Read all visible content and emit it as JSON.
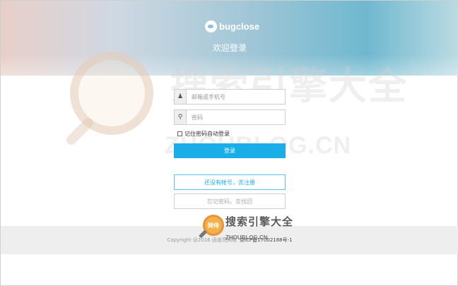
{
  "header": {
    "logo_text": "bugclose",
    "welcome": "欢迎登录"
  },
  "login_form": {
    "account": {
      "placeholder": "邮箱或手机号",
      "value": "",
      "icon": "user-icon"
    },
    "password": {
      "placeholder": "密码",
      "value": "",
      "icon": "key-icon"
    },
    "remember_label": "记住密码自动登录",
    "remember_checked": false,
    "login_button": "登录"
  },
  "links": {
    "register": "还没有帐号，去注册",
    "forgot": "忘记密码，去找回"
  },
  "footer": {
    "copyright": "Copyright @2016 函道亮网络",
    "icp": "京ICP备17002188号-1"
  },
  "watermark": {
    "site_cn": "搜索引擎大全",
    "site_url": "ZHOUBLOG.CN",
    "badge": "网侍"
  },
  "colors": {
    "primary": "#1aaee8",
    "footer_bg": "#eeeeee"
  }
}
